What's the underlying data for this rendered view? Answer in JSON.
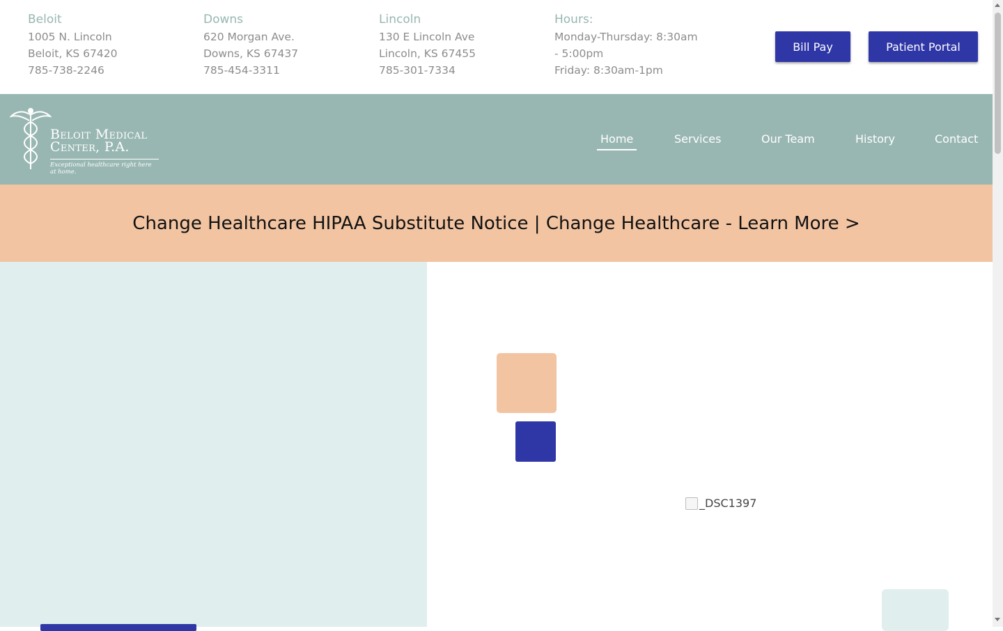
{
  "locations": [
    {
      "name": "Beloit",
      "address": "1005 N. Lincoln",
      "city": "Beloit, KS 67420",
      "phone": "785-738-2246"
    },
    {
      "name": "Downs",
      "address": "620 Morgan Ave.",
      "city": "Downs, KS 67437",
      "phone": "785-454-3311"
    },
    {
      "name": "Lincoln",
      "address": "130 E Lincoln Ave",
      "city": "Lincoln, KS 67455",
      "phone": "785-301-7334"
    }
  ],
  "hours": {
    "title": "Hours:",
    "line1": "Monday-Thursday: 8:30am",
    "line2": "- 5:00pm",
    "line3": "Friday: 8:30am-1pm"
  },
  "buttons": {
    "bill_pay": "Bill Pay",
    "patient_portal": "Patient Portal"
  },
  "logo": {
    "line1": "Beloit Medical",
    "line2": "Center, P.A.",
    "tagline": "Exceptional healthcare right here at home."
  },
  "nav": [
    "Home",
    "Services",
    "Our Team",
    "History",
    "Contact"
  ],
  "banner": {
    "text": "Change Healthcare HIPAA Substitute Notice | Change Healthcare - Learn More >"
  },
  "hero": {
    "image_alt": "_DSC1397"
  },
  "colors": {
    "primary": "#2f36a6",
    "nav_bg": "#99b7b2",
    "banner_bg": "#f2c4a2",
    "hero_left_bg": "#e0efee"
  }
}
